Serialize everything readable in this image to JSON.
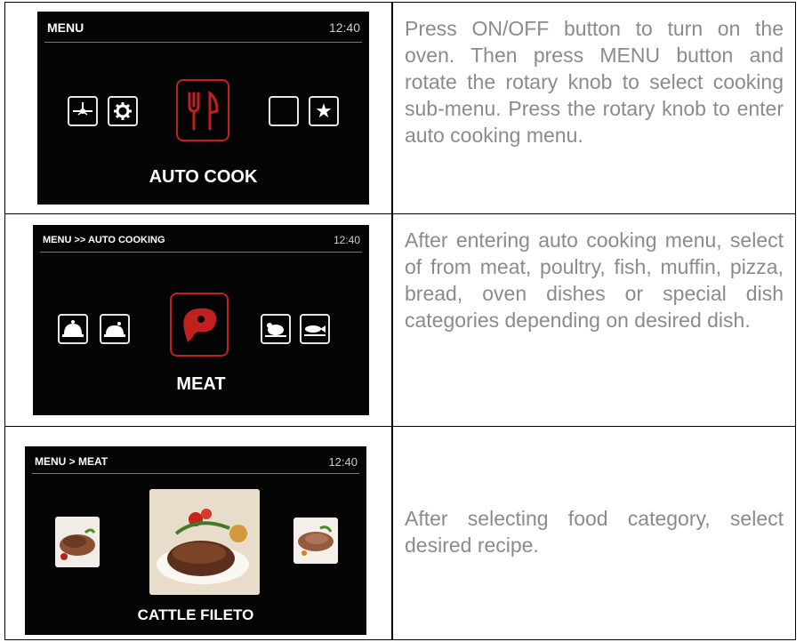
{
  "rows": [
    {
      "screen": {
        "title": "MENU",
        "time": "12:40",
        "label": "AUTO COOK",
        "icons": [
          "timer-fan-icon",
          "gear-icon",
          "cutlery-icon",
          "blank-icon",
          "star-icon"
        ]
      },
      "text": "Press ON/OFF button to turn on the oven. Then press MENU button and rotate the rotary knob to select cooking sub-menu. Press the rotary knob to enter auto cooking menu."
    },
    {
      "screen": {
        "title": "MENU >> AUTO COOKING",
        "time": "12:40",
        "label": "MEAT",
        "icons": [
          "covered-dish-icon",
          "roast-dish-icon",
          "meat-icon",
          "poultry-icon",
          "fish-icon"
        ]
      },
      "text": "After entering auto cooking menu, select of from meat, poultry, fish, muffin, pizza, bread, oven dishes or special dish categories depending on desired dish."
    },
    {
      "screen": {
        "title": "MENU > MEAT",
        "time": "12:40",
        "label": "CATTLE FILETO"
      },
      "text": "After selecting food category, select desired recipe."
    }
  ],
  "colors": {
    "screen_bg": "#050505",
    "accent": "#c0201e",
    "body_text": "#8b8b8b"
  }
}
